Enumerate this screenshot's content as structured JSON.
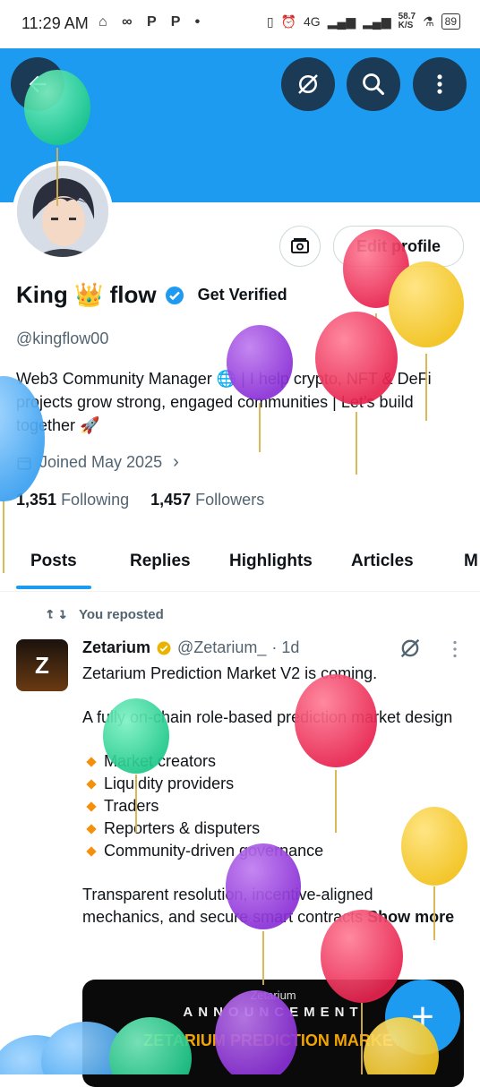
{
  "status_bar": {
    "time": "11:29 AM",
    "left_icons": "⌂ ∞ P P •",
    "network": "4G",
    "speed": "58.7",
    "speed_unit": "K/S",
    "battery": "89"
  },
  "profile": {
    "name": "King 👑 flow",
    "get_verified": "Get Verified",
    "handle": "@kingflow00",
    "bio": "Web3 Community Manager 🌐 | I help crypto, NFT & DeFi projects grow strong, engaged communities | Let’s build together 🚀",
    "joined": "Joined May 2025",
    "following_count": "1,351",
    "following_label": "Following",
    "followers_count": "1,457",
    "followers_label": "Followers",
    "edit_profile": "Edit profile"
  },
  "tabs": [
    {
      "label": "Posts"
    },
    {
      "label": "Replies"
    },
    {
      "label": "Highlights"
    },
    {
      "label": "Articles"
    },
    {
      "label": "M"
    }
  ],
  "post": {
    "repost_label": "You reposted",
    "author": "Zetarium",
    "author_handle": "@Zetarium_",
    "time": "· 1d",
    "logo_letter": "Z",
    "line1": "Zetarium Prediction Market V2 is coming.",
    "line2": "A fully on-chain role-based prediction market design",
    "bullets": [
      "Market creators",
      "Liquidity providers",
      "Traders",
      "Reporters & disputers",
      "Community-driven governance"
    ],
    "line3": "Transparent resolution, incentive-aligned mechanics, and secure smart contracts",
    "show_more": "Show more",
    "media_brand": "Zetarium",
    "media_announce": "ANNOUNCEMENT",
    "media_headline": "ZETARIUM PREDICTION MARKET"
  },
  "fab_label": "+",
  "colors": {
    "accent": "#1d9bf0",
    "banner": "#1d9bf0",
    "text": "#0f1419",
    "muted": "#536471"
  }
}
